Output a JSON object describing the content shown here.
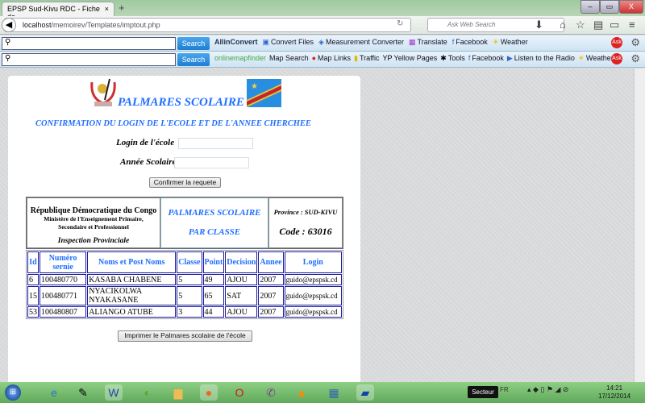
{
  "browser": {
    "tab_title": "EPSP Sud-Kivu RDC - Fiche de ...",
    "tab_close": "×",
    "new_tab": "+",
    "url_host": "localhost",
    "url_path": "/memoirev/Templates/imptout.php",
    "search_placeholder": "Ask Web Search",
    "window_buttons": [
      "–",
      "▭",
      "X"
    ]
  },
  "toolbar1": {
    "search_label": "Search",
    "brand": "AllinConvert",
    "items": [
      "Convert Files",
      "Measurement Converter",
      "Translate",
      "Facebook",
      "Weather"
    ]
  },
  "toolbar2": {
    "search_label": "Search",
    "brand": "onlinemapfinder",
    "items": [
      "Map Search",
      "Map Links",
      "Traffic",
      "Yellow Pages",
      "Tools",
      "Facebook",
      "Listen to the Radio",
      "Weather"
    ]
  },
  "toolbar_ask": "Ask",
  "page": {
    "title": "PALMARES SCOLAIRE",
    "subtitle": "CONFIRMATION DU LOGIN DE L'ECOLE ET DE L'ANNEE CHERCHEE",
    "login_label": "Login de l'école",
    "login_value": "",
    "year_label": "Année Scolaire",
    "year_value": "",
    "confirm_button": "Confirmer la requete",
    "header": {
      "country": "République Démocratique du Congo",
      "ministry": "Ministère de l'Enseignement Primaire, Secondaire et Professionnel",
      "inspection": "Inspection Provinciale",
      "palmares": "PALMARES SCOLAIRE",
      "par_classe": "PAR CLASSE",
      "province": "Province : SUD-KIVU",
      "code": "Code : 63016"
    },
    "table": {
      "columns": [
        "Id",
        "Numéro sernie",
        "Noms et Post Noms",
        "Classe",
        "Point",
        "Decision",
        "Annee",
        "Login"
      ],
      "rows": [
        [
          "6",
          "100480770",
          "KASABA CHABENE",
          "5",
          "49",
          "AJOU",
          "2007",
          "guido@epspsk.cd"
        ],
        [
          "15",
          "100480771",
          "NYACIKOLWA NYAKASANE",
          "5",
          "65",
          "SAT",
          "2007",
          "guido@epspsk.cd"
        ],
        [
          "53",
          "100480807",
          "ALIANGO ATUBE",
          "3",
          "44",
          "AJOU",
          "2007",
          "guido@epspsk.cd"
        ]
      ]
    },
    "print_button": "Imprimer le Palmares scolaire de l'école"
  },
  "taskbar": {
    "sector": "Secteur",
    "lang": "FR",
    "time": "14:21",
    "date": "17/12/2014"
  },
  "colors": {
    "accent_blue": "#1f6fff",
    "table_border": "#1a1aa0"
  }
}
